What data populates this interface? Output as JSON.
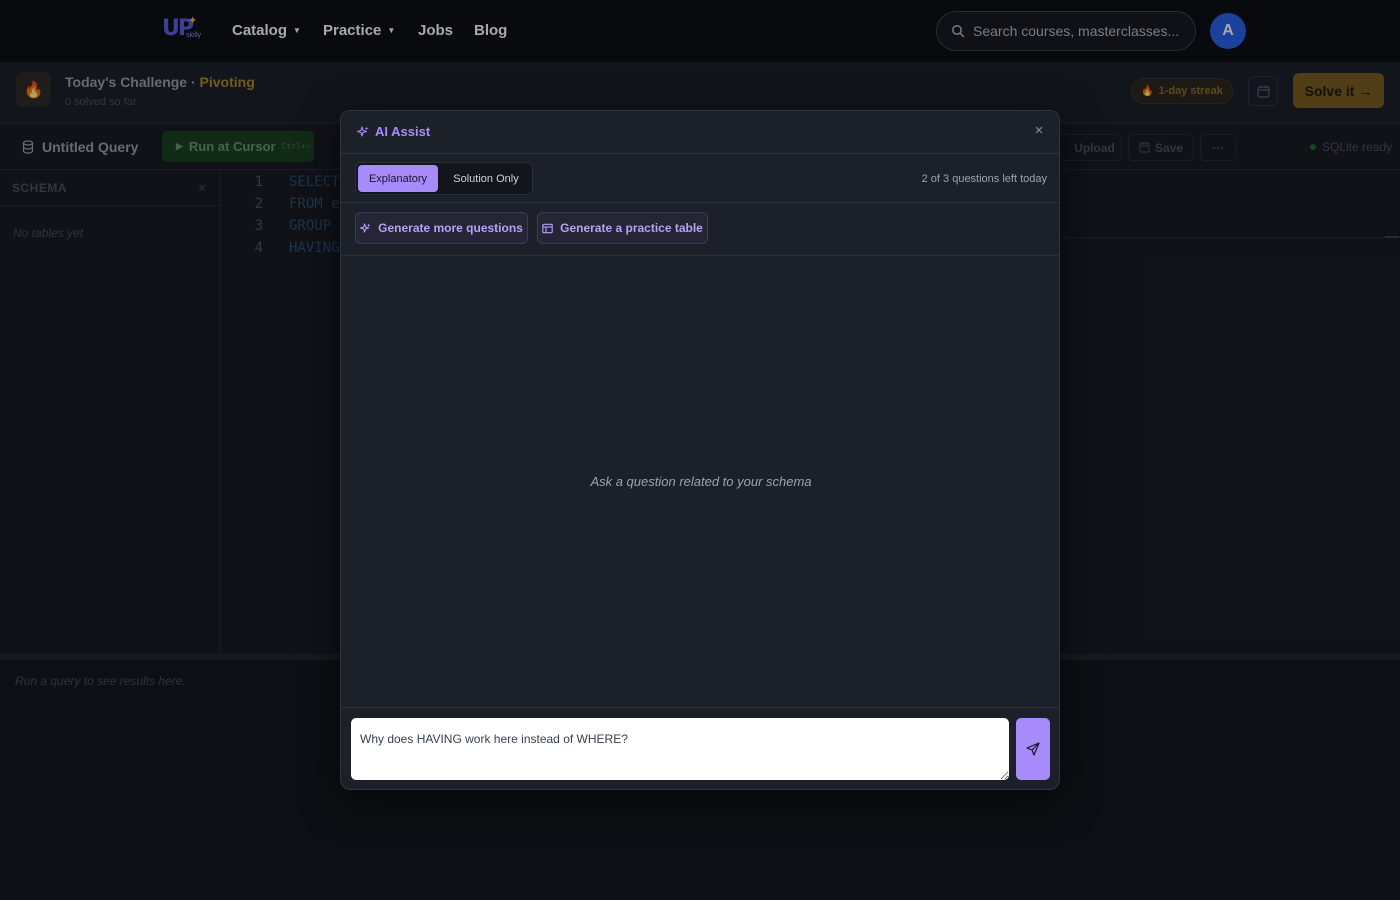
{
  "nav": {
    "logo_text": "UP",
    "logo_sub": "skilly",
    "items": [
      {
        "label": "Catalog",
        "has_caret": true
      },
      {
        "label": "Practice",
        "has_caret": true
      },
      {
        "label": "Jobs",
        "has_caret": false
      },
      {
        "label": "Blog",
        "has_caret": false
      }
    ],
    "search_placeholder": "Search courses, masterclasses...",
    "avatar_initial": "A",
    "avatar_color": "#2563eb"
  },
  "challenge": {
    "title": "Today's Challenge · ",
    "topic": "Pivoting",
    "subtitle": "0 solved so far",
    "streak_label": "1-day streak",
    "solve_label": "Solve it →"
  },
  "toolbar": {
    "query_name": "Untitled Query",
    "run_label": "Run at Cursor",
    "run_shortcut": "Ctrl+⏎",
    "upload_label": "Upload",
    "save_label": "Save",
    "more_label": "···",
    "status_label": "SQLite ready"
  },
  "schema": {
    "title": "SCHEMA",
    "empty_text": "No tables yet"
  },
  "editor": {
    "lines": [
      {
        "num": "1",
        "code": "SELECT"
      },
      {
        "num": "2",
        "code": "FROM e"
      },
      {
        "num": "3",
        "code": "GROUP"
      },
      {
        "num": "4",
        "code": "HAVING"
      }
    ]
  },
  "results": {
    "empty_text": "Run a query to see results here."
  },
  "modal": {
    "title": "AI Assist",
    "close_label": "×",
    "modes": [
      {
        "label": "Explanatory",
        "active": true
      },
      {
        "label": "Solution Only",
        "active": false
      }
    ],
    "quota_text": "2 of 3 questions left today",
    "actions": [
      {
        "label": "Generate more questions",
        "icon": "sparkle-icon"
      },
      {
        "label": "Generate a practice table",
        "icon": "table-icon"
      }
    ],
    "empty_text": "Ask a question related to your schema",
    "input_value": "Why does HAVING work here instead of WHERE?",
    "accent_color": "#a78bfa"
  }
}
